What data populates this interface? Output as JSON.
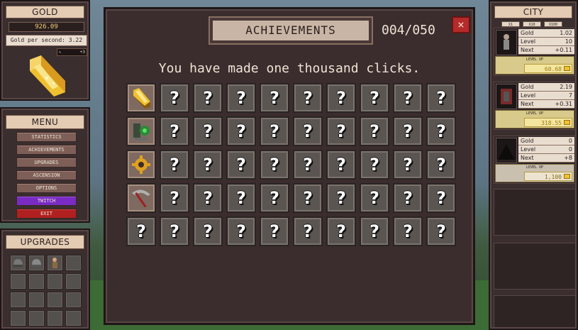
{
  "gold_panel": {
    "title": "GOLD",
    "amount": "926.09",
    "per_second": "Gold per second: 3.22",
    "click_bonus": "+3"
  },
  "menu": {
    "title": "MENU",
    "items": [
      "STATISTICS",
      "ACHIEVEMENTS",
      "UPGRADES",
      "ASCENSION",
      "OPTIONS",
      "TWITCH",
      "EXIT"
    ]
  },
  "upgrades": {
    "title": "UPGRADES"
  },
  "achievements": {
    "title": "ACHIEVEMENTS",
    "count": "004/050",
    "close": "×",
    "message": "You have made one thousand clicks.",
    "unlocked_icons": [
      "gold-bar-icon",
      "green-gauntlet-icon",
      "gold-gear-icon",
      "pickaxe-icon"
    ]
  },
  "city": {
    "title": "CITY",
    "multipliers": [
      "X1",
      "X10",
      "X100"
    ],
    "buildings": [
      {
        "gold_label": "Gold",
        "gold": "1.02",
        "level_label": "Level",
        "level": "10",
        "next_label": "Next",
        "next": "+0.11",
        "levelup": "LEVEL UP",
        "cost": "60.68"
      },
      {
        "gold_label": "Gold",
        "gold": "2.19",
        "level_label": "Level",
        "level": "7",
        "next_label": "Next",
        "next": "+0.31",
        "levelup": "LEVEL UP",
        "cost": "318.55"
      },
      {
        "gold_label": "Gold",
        "gold": "0",
        "level_label": "Level",
        "level": "0",
        "next_label": "Next",
        "next": "+8",
        "levelup": "LEVEL UP",
        "cost": "1,100"
      }
    ]
  },
  "colors": {
    "panel": "#3a2e2e",
    "twitch": "#7a2bc4",
    "exit": "#b02020",
    "close": "#b52a2a",
    "gold": "#f0c030"
  }
}
